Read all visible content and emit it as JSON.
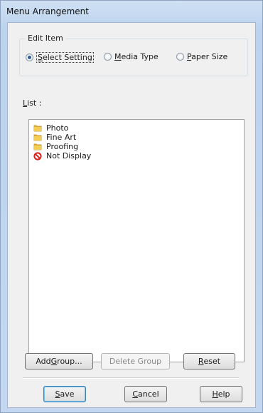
{
  "window": {
    "title": "Menu Arrangement"
  },
  "edit_item": {
    "label": "Edit Item",
    "options": [
      {
        "first": "S",
        "rest": "elect Setting",
        "selected": true
      },
      {
        "first": "M",
        "rest": "edia Type",
        "selected": false
      },
      {
        "first": "P",
        "rest": "aper Size",
        "selected": false
      }
    ]
  },
  "list": {
    "label_first": "L",
    "label_rest": "ist :",
    "items": [
      {
        "label": "Photo",
        "icon": "folder-icon"
      },
      {
        "label": "Fine Art",
        "icon": "folder-icon"
      },
      {
        "label": "Proofing",
        "icon": "folder-icon"
      },
      {
        "label": "Not Display",
        "icon": "no-entry-icon"
      }
    ]
  },
  "buttons": {
    "add_group_pre": "Add ",
    "add_group_key": "G",
    "add_group_post": "roup...",
    "delete_group": "Delete Group",
    "reset_key": "R",
    "reset_rest": "eset",
    "save_key": "S",
    "save_rest": "ave",
    "cancel_key": "C",
    "cancel_rest": "ancel",
    "help_key": "H",
    "help_rest": "elp"
  },
  "colors": {
    "folder": "#e8b531",
    "no_entry": "#d9221c",
    "radio_dot": "#2d5d96"
  }
}
